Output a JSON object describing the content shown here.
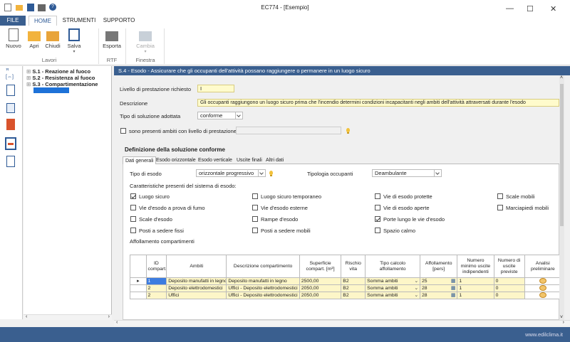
{
  "window": {
    "title": "EC774 - [Esempio]",
    "minimize": "—",
    "maximize": "☐",
    "close": "✕"
  },
  "tabs": [
    "FILE",
    "HOME",
    "STRUMENTI",
    "SUPPORTO"
  ],
  "ribbon": {
    "buttons": {
      "nuovo": "Nuovo",
      "apri": "Apri",
      "chiudi": "Chiudi",
      "salva": "Salva",
      "esporta": "Esporta",
      "cambia": "Cambia"
    },
    "groups": {
      "lavori": "Lavori",
      "rtf": "RTF",
      "finestra": "Finestra"
    }
  },
  "tree": {
    "items": [
      "S.1 - Reazione al fuoco",
      "S.2 - Resistenza al fuoco",
      "S.3 - Compartimentazione"
    ]
  },
  "main": {
    "header": "S.4 - Esodo - Assicurare che gli occupanti dell'attività possano raggiungere o permanere in un luogo sicuro",
    "livello_label": "Livello di prestazione richiesto",
    "livello_value": "I",
    "descrizione_label": "Descrizione",
    "descrizione_value": "Gli occupanti raggiungono un luogo sicuro prima che l'incendio determini condizioni incapacitanti negli ambiti dell'attività attraversati durante l'esodo",
    "tipo_soluzione_label": "Tipo di soluzione adottata",
    "tipo_soluzione_value": "conforme",
    "ambiti_label": "sono presenti ambiti con livello di prestazione II",
    "definizione_title": "Definizione della soluzione conforme",
    "subtabs": [
      "Dati generali",
      "Esodo orizzontale",
      "Esodo verticale",
      "Uscite finali",
      "Altri dati"
    ],
    "tipo_esodo_label": "Tipo di esodo",
    "tipo_esodo_value": "orizzontale progressivo",
    "tipologia_label": "Tipologia occupanti",
    "tipologia_value": "Deambulante",
    "caratteristiche_label": "Caratteristiche presenti del sistema di esodo:",
    "checks": [
      {
        "label": "Luogo sicuro",
        "checked": true
      },
      {
        "label": "Luogo sicuro temporaneo",
        "checked": false
      },
      {
        "label": "Vie di esodo protette",
        "checked": false
      },
      {
        "label": "Scale mobili",
        "checked": false
      },
      {
        "label": "Vie d'esodo a prova di fumo",
        "checked": false
      },
      {
        "label": "Vie d'esodo esterne",
        "checked": false
      },
      {
        "label": "Vie di esodo aperte",
        "checked": false
      },
      {
        "label": "Marciapiedi mobili",
        "checked": false
      },
      {
        "label": "Scale d'esodo",
        "checked": false
      },
      {
        "label": "Rampe d'esodo",
        "checked": false
      },
      {
        "label": "Porte lungo le vie d'esodo",
        "checked": true
      },
      {
        "label": "Posti a sedere fissi",
        "checked": false
      },
      {
        "label": "Posti a sedere mobili",
        "checked": false
      },
      {
        "label": "Spazio calmo",
        "checked": false
      }
    ],
    "affollamento_label": "Affollamento compartimenti",
    "table": {
      "headers": [
        "ID compart.",
        "Ambiti",
        "Descrizione compartimento",
        "Superficie compart. [m²]",
        "Rischio vita",
        "Tipo calcolo affollamento",
        "Affollamento [pers]",
        "Numero minimo uscite indipendenti",
        "Numero di uscite previste",
        "Analisi preliminare"
      ],
      "rows": [
        [
          "1",
          "Deposito manufatti in legno",
          "Deposito manufatti in legno",
          "2500,00",
          "B2",
          "Somma ambiti",
          "25",
          "1",
          "0"
        ],
        [
          "2",
          "Deposito elettrodomestici",
          "Uffici - Deposito elettrodomestici",
          "2050,00",
          "B2",
          "Somma ambiti",
          "28",
          "1",
          "0"
        ],
        [
          "2",
          "Uffici",
          "Uffici - Deposito elettrodomestici",
          "2050,00",
          "B2",
          "Somma ambiti",
          "28",
          "1",
          "0"
        ]
      ]
    }
  },
  "status": {
    "website": "www.edilclima.it"
  },
  "colors": {
    "accent": "#3a5f8f",
    "yellow_field": "#fffbcc",
    "selection": "#3d7ce0"
  }
}
